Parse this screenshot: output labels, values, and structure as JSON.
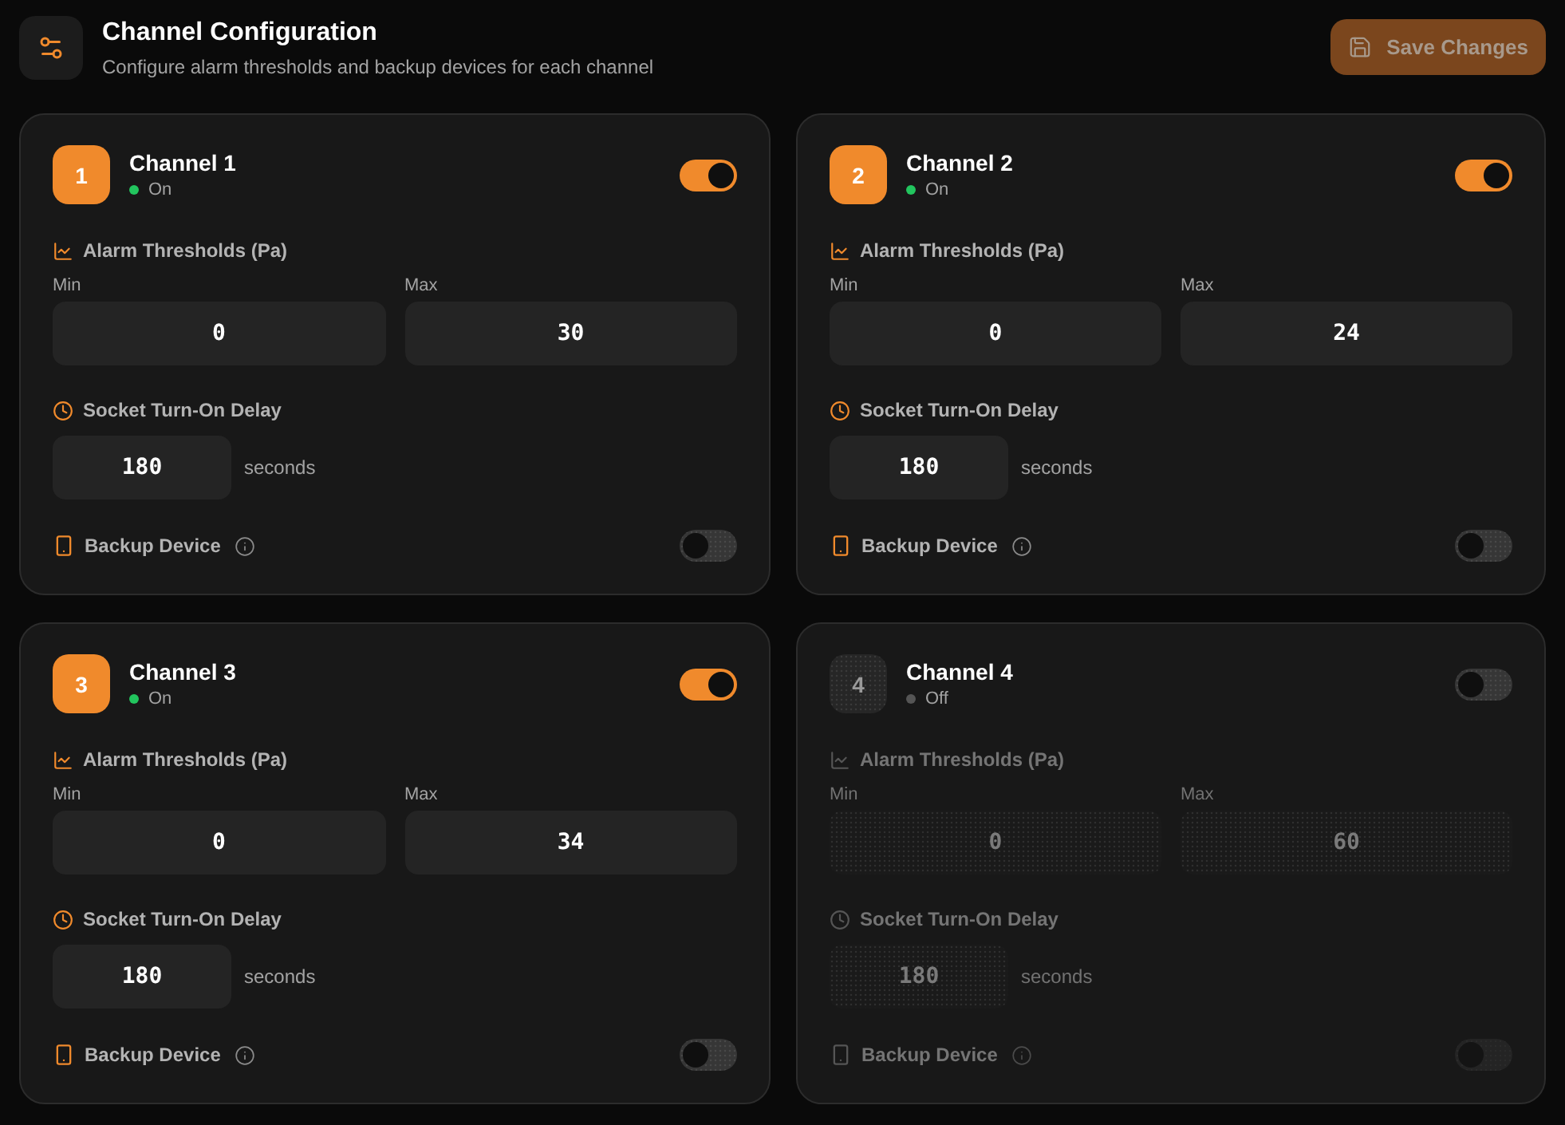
{
  "header": {
    "title": "Channel Configuration",
    "subtitle": "Configure alarm thresholds and backup devices for each channel",
    "save_button": {
      "label": "Save Changes",
      "disabled": true
    }
  },
  "channels": [
    {
      "number": "1",
      "name": "Channel 1",
      "status": "On",
      "on": true,
      "thresholds_label": "Alarm Thresholds (Pa)",
      "min_label": "Min",
      "min": "0",
      "max_label": "Max",
      "max": "30",
      "delay_label": "Socket Turn-On Delay",
      "delay": "180",
      "delay_unit": "seconds",
      "backup_label": "Backup Device",
      "backup_on": false
    },
    {
      "number": "2",
      "name": "Channel 2",
      "status": "On",
      "on": true,
      "thresholds_label": "Alarm Thresholds (Pa)",
      "min_label": "Min",
      "min": "0",
      "max_label": "Max",
      "max": "24",
      "delay_label": "Socket Turn-On Delay",
      "delay": "180",
      "delay_unit": "seconds",
      "backup_label": "Backup Device",
      "backup_on": false
    },
    {
      "number": "3",
      "name": "Channel 3",
      "status": "On",
      "on": true,
      "thresholds_label": "Alarm Thresholds (Pa)",
      "min_label": "Min",
      "min": "0",
      "max_label": "Max",
      "max": "34",
      "delay_label": "Socket Turn-On Delay",
      "delay": "180",
      "delay_unit": "seconds",
      "backup_label": "Backup Device",
      "backup_on": false
    },
    {
      "number": "4",
      "name": "Channel 4",
      "status": "Off",
      "on": false,
      "thresholds_label": "Alarm Thresholds (Pa)",
      "min_label": "Min",
      "min": "0",
      "max_label": "Max",
      "max": "60",
      "delay_label": "Socket Turn-On Delay",
      "delay": "180",
      "delay_unit": "seconds",
      "backup_label": "Backup Device",
      "backup_on": false
    }
  ]
}
